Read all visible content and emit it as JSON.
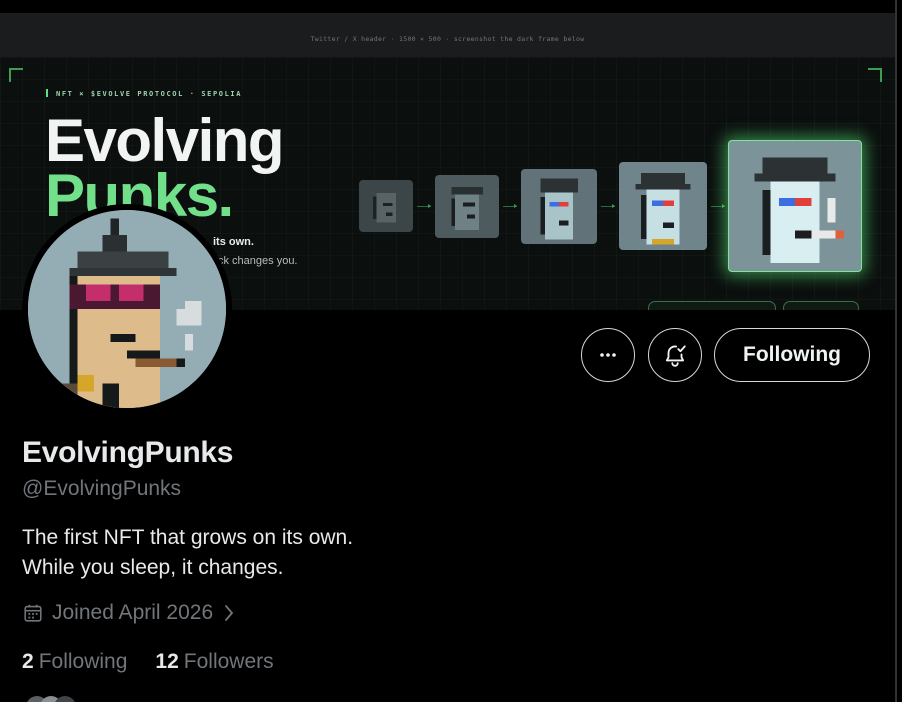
{
  "banner": {
    "caption": "Twitter / X header · 1500 × 500 · screenshot the dark frame below",
    "tagline": "NFT × $EVOLVE PROTOCOL · SEPOLIA",
    "headline_line1": "Evolving",
    "headline_line2": "Punks.",
    "sub_line1": "its own.",
    "sub_line2": "ck changes you.",
    "accent_color": "#72e08b"
  },
  "avatar": {
    "icon": "pixel-punk-avatar"
  },
  "actions": {
    "more_icon": "more-horizontal-icon",
    "notify_icon": "bell-check-icon",
    "follow_label": "Following"
  },
  "profile": {
    "display_name": "EvolvingPunks",
    "handle": "@EvolvingPunks",
    "bio_line1": "The first NFT that grows on its own.",
    "bio_line2": "While you sleep, it changes.",
    "joined": "Joined April 2026",
    "joined_icon": "calendar-icon"
  },
  "stats": {
    "following_count": "2",
    "following_label": "Following",
    "followers_count": "12",
    "followers_label": "Followers"
  },
  "colors": {
    "background": "#000000",
    "text": "#e7e9ea",
    "muted": "#71767b",
    "border": "#cfd9de"
  }
}
